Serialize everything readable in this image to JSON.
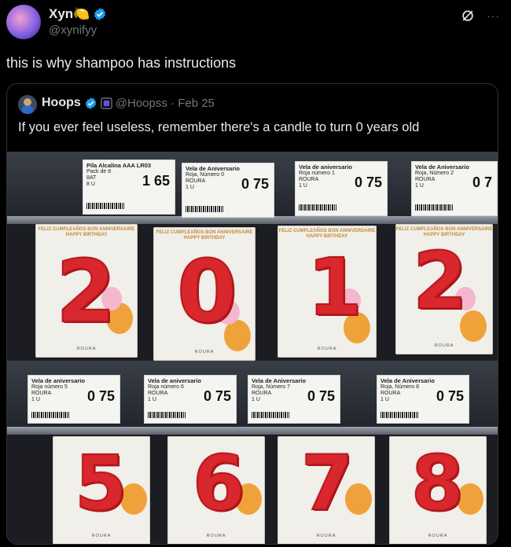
{
  "author": {
    "display_name": "Xyn🍋",
    "handle": "@xynifyy"
  },
  "post_text": "this is why shampoo has instructions",
  "quote": {
    "display_name": "Hoops",
    "handle_date": "@Hoopss · Feb 25",
    "text": "If you ever feel useless, remember there's a candle to turn 0 years old"
  },
  "icons": {
    "verified": "verified-badge-icon",
    "grok": "grok-icon",
    "more": "more-options-icon"
  },
  "colors": {
    "accent": "#1d9bf0",
    "background": "#000000",
    "candle": "#d8272d"
  },
  "more_label": "···",
  "photo": {
    "top_tags": [
      {
        "title": "Pila Alcalina AAA LR03",
        "line2": "Pack de 8",
        "line3": "8AT",
        "line4": "8 U",
        "price": "1 65"
      },
      {
        "title": "Vela de Aniversario",
        "line2": "Roja, Número 0",
        "line3": "ROURA",
        "line4": "1 U",
        "price": "0 75"
      },
      {
        "title": "Vela de aniversario",
        "line2": "Roja número 1",
        "line3": "ROURA",
        "line4": "1 U",
        "price": "0 75"
      },
      {
        "title": "Vela de Aniversario",
        "line2": "Roja, Número 2",
        "line3": "ROURA",
        "line4": "1 U",
        "price": "0 7"
      }
    ],
    "bottom_tags": [
      {
        "title": "Vela de aniversario",
        "line2": "Roja número 5",
        "line3": "ROURA",
        "line4": "1 U",
        "price": "0 75"
      },
      {
        "title": "Vela de aniversario",
        "line2": "Roja número 6",
        "line3": "ROURA",
        "line4": "1 U",
        "price": "0 75"
      },
      {
        "title": "Vela de Aniversario",
        "line2": "Roja, Número 7",
        "line3": "ROURA",
        "line4": "1 U",
        "price": "0 75"
      },
      {
        "title": "Vela de Aniversario",
        "line2": "Roja, Número 8",
        "line3": "ROURA",
        "line4": "1 U",
        "price": "0 75"
      }
    ],
    "top_digits": [
      "2",
      "0",
      "1",
      "2"
    ],
    "bottom_digits": [
      "5",
      "6",
      "7",
      "8"
    ],
    "pack_banner": "FELIZ CUMPLEAÑOS BON ANNIVERSAIRE HAPPY BIRTHDAY",
    "pack_brand": "ROURA"
  }
}
